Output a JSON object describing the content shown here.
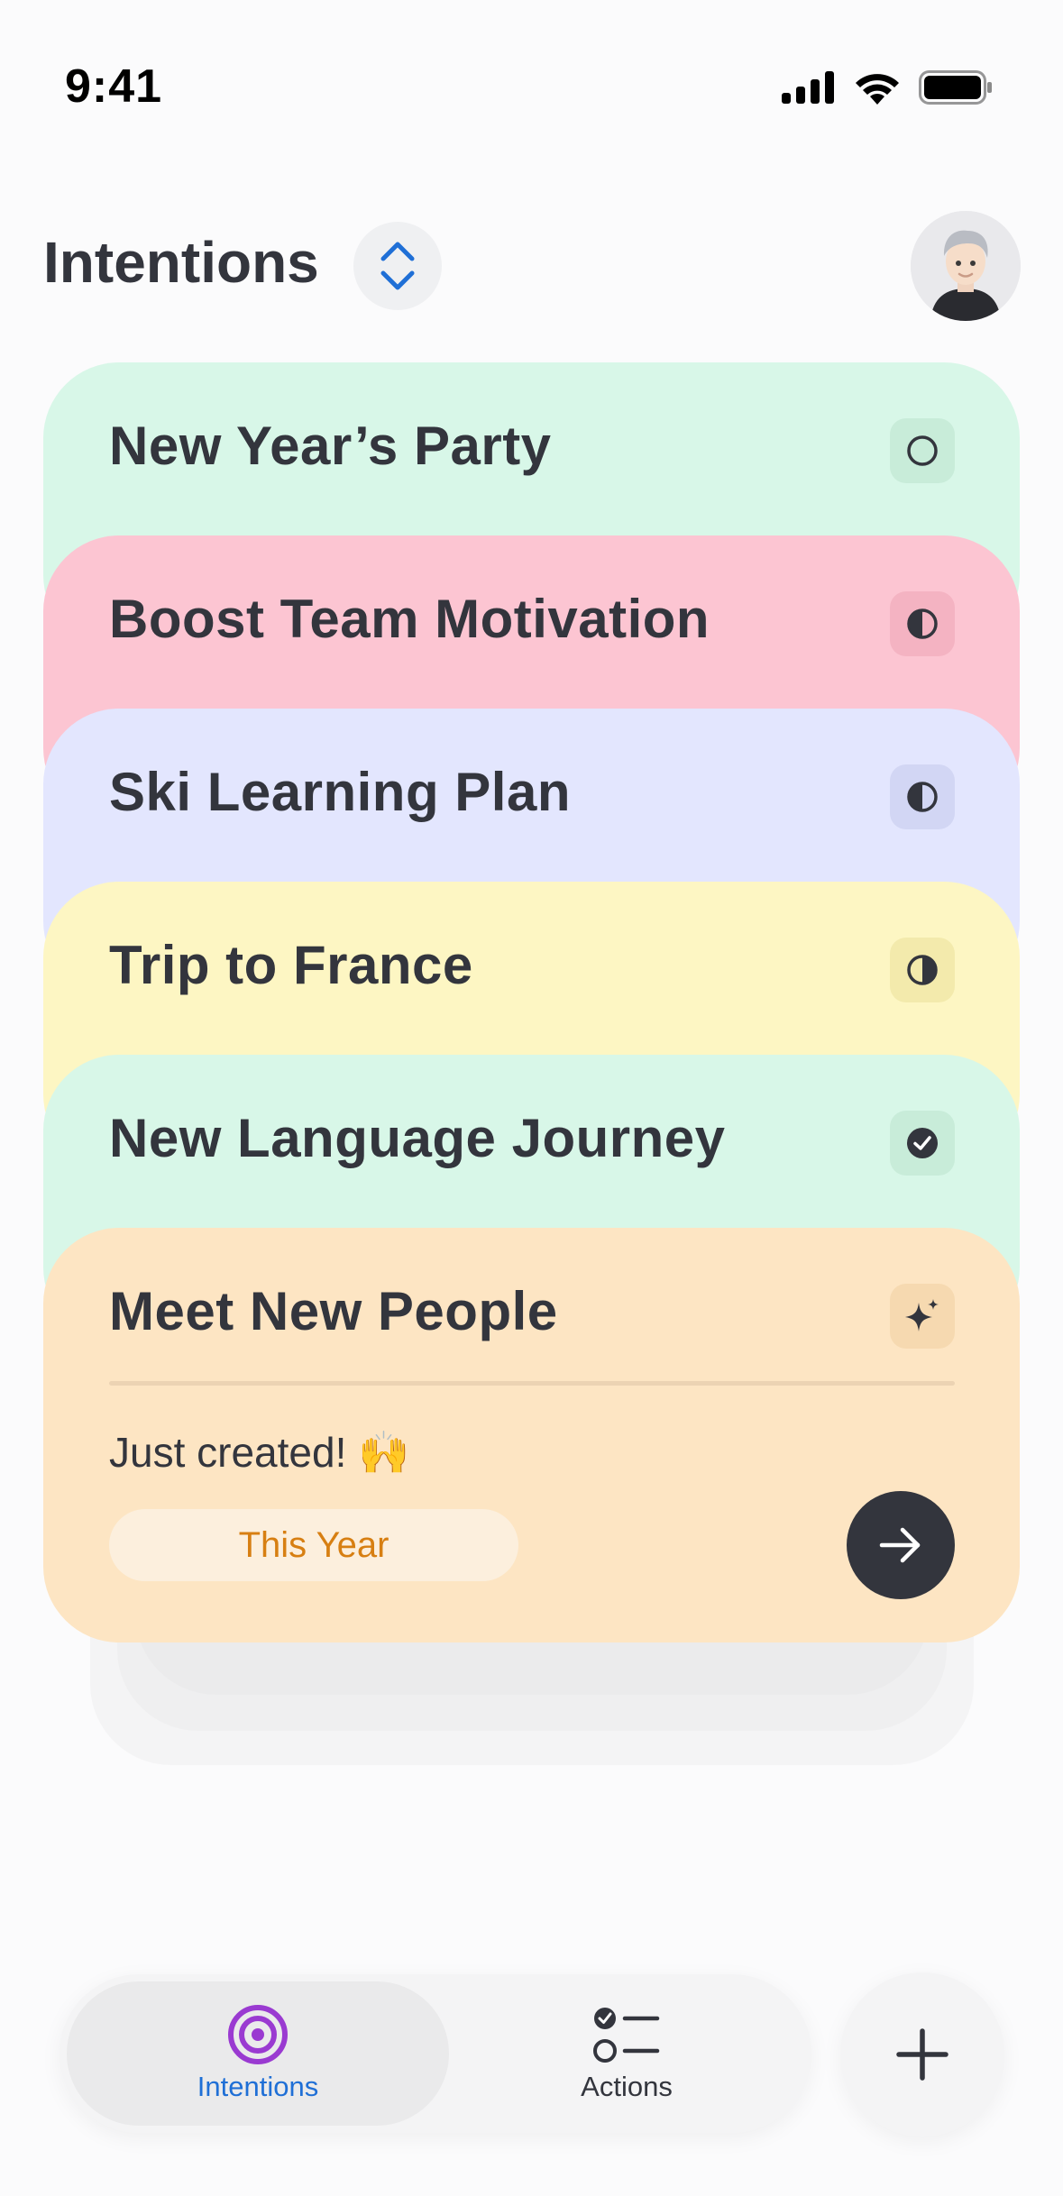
{
  "status_bar": {
    "time": "9:41",
    "icons": [
      "signal-icon",
      "wifi-icon",
      "battery-icon"
    ]
  },
  "header": {
    "title": "Intentions",
    "sort_icon": "chevron-up-down-icon",
    "avatar": "avatar"
  },
  "cards": [
    {
      "title": "New Year’s Party",
      "color": "#d8f7e8",
      "chip_color": "#c8ecd9",
      "status_icon": "empty-circle-icon"
    },
    {
      "title": "Boost Team Motivation",
      "color": "#fcc5d2",
      "chip_color": "#f4b3c2",
      "status_icon": "half-circle-icon"
    },
    {
      "title": "Ski Learning Plan",
      "color": "#e3e6fe",
      "chip_color": "#d2d6f4",
      "status_icon": "half-circle-icon"
    },
    {
      "title": "Trip to France",
      "color": "#fdf6c3",
      "chip_color": "#f3eaac",
      "status_icon": "half-circle-icon"
    },
    {
      "title": "New Language Journey",
      "color": "#d8f7e8",
      "chip_color": "#c8ecd9",
      "status_icon": "check-circle-icon"
    },
    {
      "title": "Meet New People",
      "color": "#fde5c3",
      "chip_color": "#f6d9b0",
      "status_icon": "sparkle-icon"
    }
  ],
  "expanded_card": {
    "note": "Just created! 🙌",
    "tag": "This Year",
    "action_icon": "arrow-right-icon"
  },
  "nav": {
    "items": [
      {
        "label": "Intentions",
        "icon": "target-icon",
        "active": true,
        "color": "#1f6fd6",
        "icon_color": "#9a3ad1"
      },
      {
        "label": "Actions",
        "icon": "checklist-icon",
        "active": false,
        "color": "#33353d"
      }
    ],
    "add_icon": "plus-icon"
  }
}
